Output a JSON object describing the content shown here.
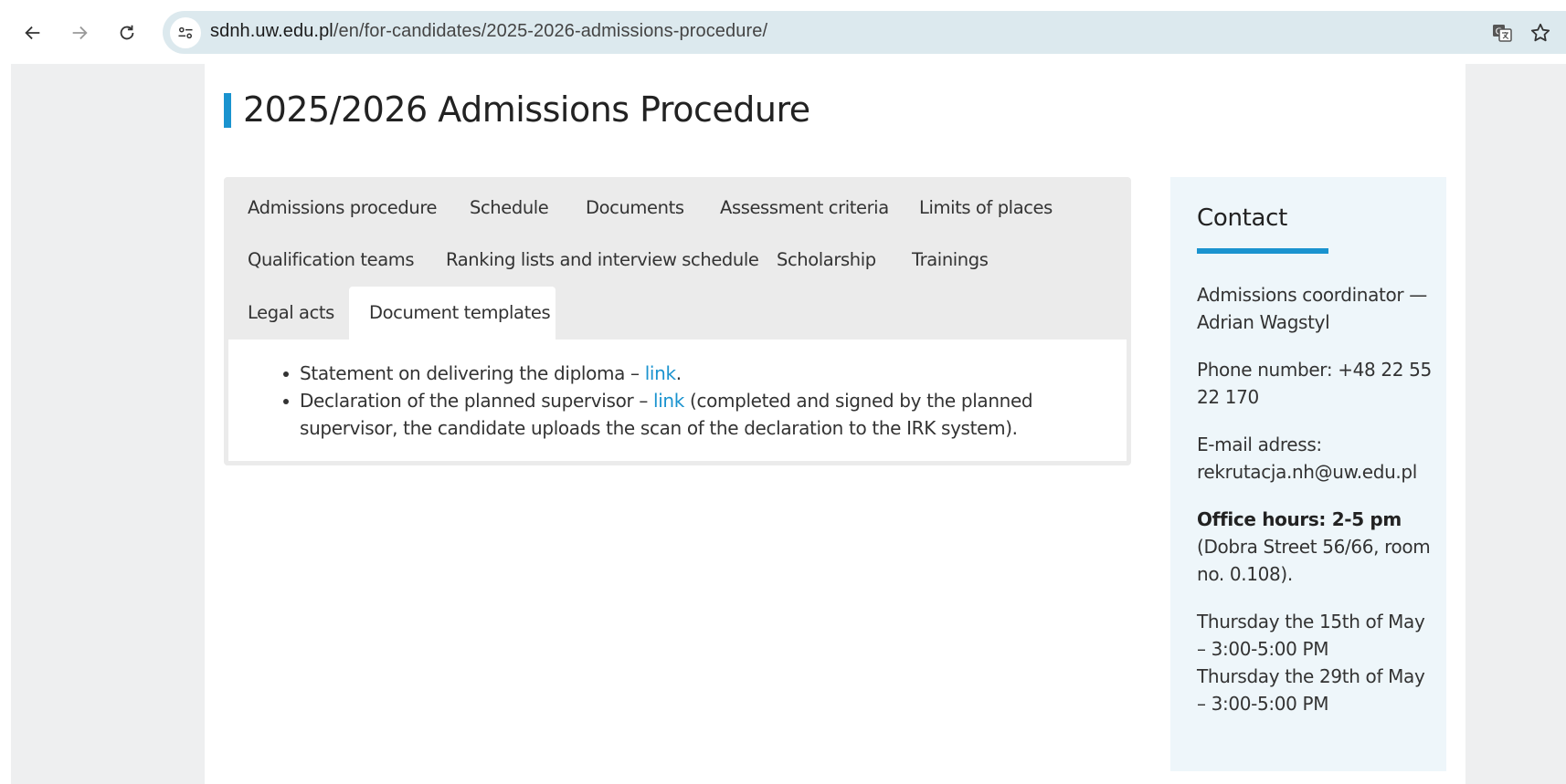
{
  "browser": {
    "url_host": "sdnh.uw.edu.pl",
    "url_path": "/en/for-candidates/2025-2026-admissions-procedure/",
    "icons": [
      "back-arrow-icon",
      "forward-arrow-icon",
      "reload-icon",
      "site-info-icon",
      "translate-icon",
      "bookmark-star-icon"
    ]
  },
  "page": {
    "title": "2025/2026 Admissions Procedure"
  },
  "tabs": {
    "items": [
      "Admissions procedure",
      "Schedule",
      "Documents",
      "Assessment criteria",
      "Limits of places",
      "Qualification teams",
      "Ranking lists and interview schedule",
      "Scholarship",
      "Trainings",
      "Legal acts",
      "Document templates"
    ],
    "active": "Document templates"
  },
  "content": {
    "item1_text": "Statement on delivering the diploma – ",
    "item1_link": "link",
    "item1_end": ".",
    "item2_text": "Declaration of the planned supervisor – ",
    "item2_link": "link",
    "item2_end": " (completed and signed by the planned supervisor, the candidate uploads the scan of the declaration to the IRK system)."
  },
  "contact": {
    "title": "Contact",
    "coordinator": "Admissions coordinator — Adrian Wagstyl",
    "phone": "Phone number: +48 22 55 22 170",
    "email_label": "E-mail adress:",
    "email": "rekrutacja.nh@uw.edu.pl",
    "office_hours_label": "Office hours: 2-5 pm",
    "office_location": "(Dobra Street 56/66, room no. 0.108).",
    "date1": "Thursday the 15th of May – 3:00-5:00 PM",
    "date2": "Thursday the 29th of May – 3:00-5:00 PM"
  },
  "colors": {
    "accent": "#1a93cf",
    "omnibox": "#dce9ee",
    "tabs_bg": "#ebebeb",
    "sidebar_bg": "#eef6fa"
  }
}
